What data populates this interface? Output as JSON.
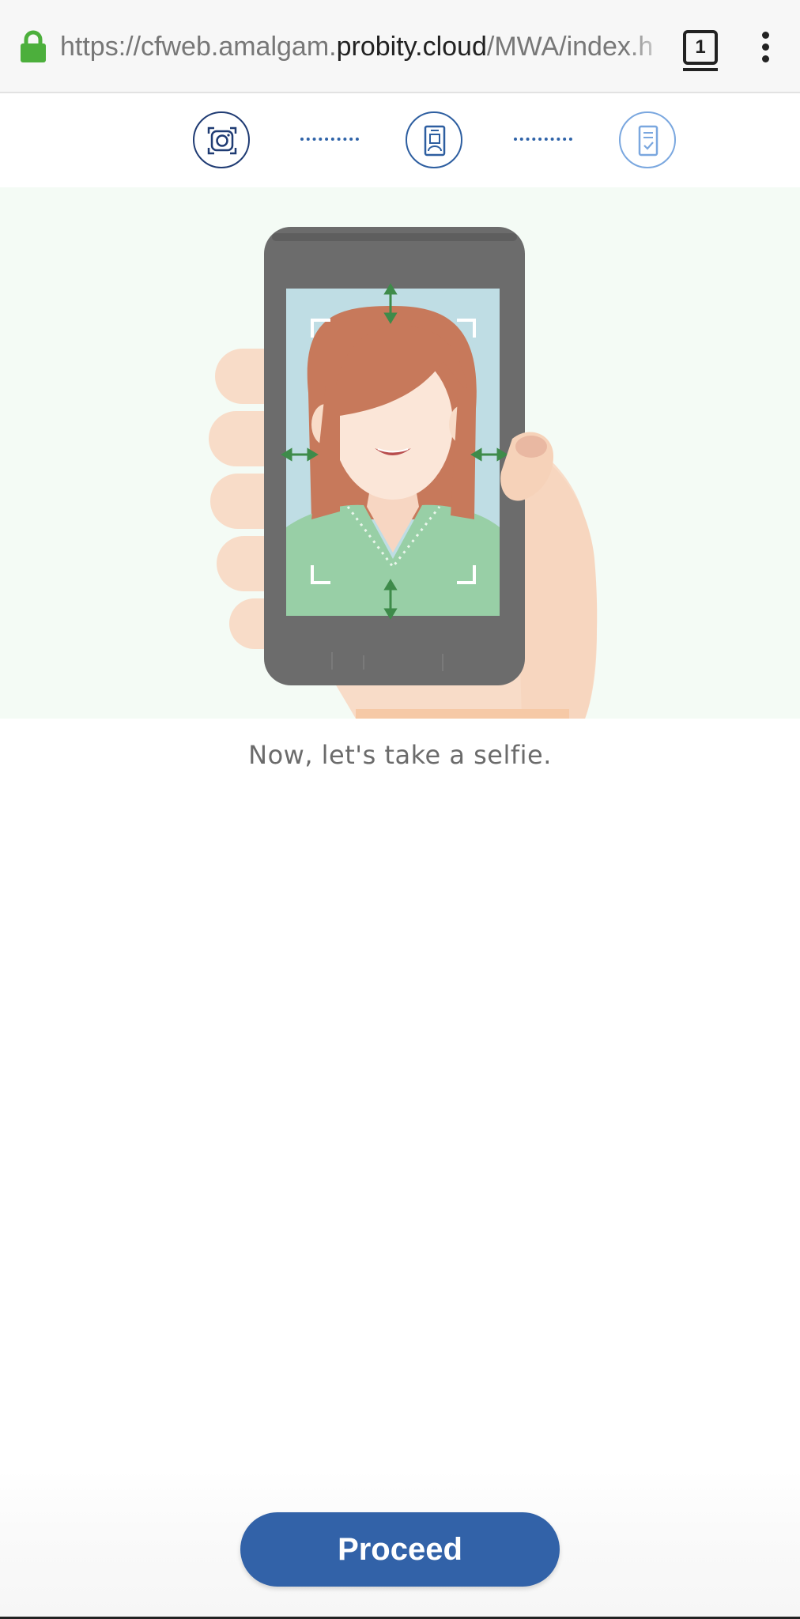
{
  "browser": {
    "url_prefix": "https://cfweb.amalgam.",
    "url_host": "probity.cloud",
    "url_suffix": "/MWA/index.h",
    "tab_count": "1",
    "lock_color": "#4caf3c",
    "icons": [
      "lock-icon",
      "tabs-icon",
      "more-options-icon"
    ]
  },
  "stepper": {
    "steps": [
      {
        "icon": "camera-frame-icon",
        "state": "active"
      },
      {
        "icon": "id-card-icon",
        "state": "upcoming"
      },
      {
        "icon": "checklist-document-icon",
        "state": "upcoming"
      }
    ],
    "accent": "#2f63a8"
  },
  "main": {
    "illustration": "selfie-illustration",
    "caption": "Now, let's take a selfie."
  },
  "footer": {
    "proceed_label": "Proceed",
    "button_color": "#3262a8"
  }
}
